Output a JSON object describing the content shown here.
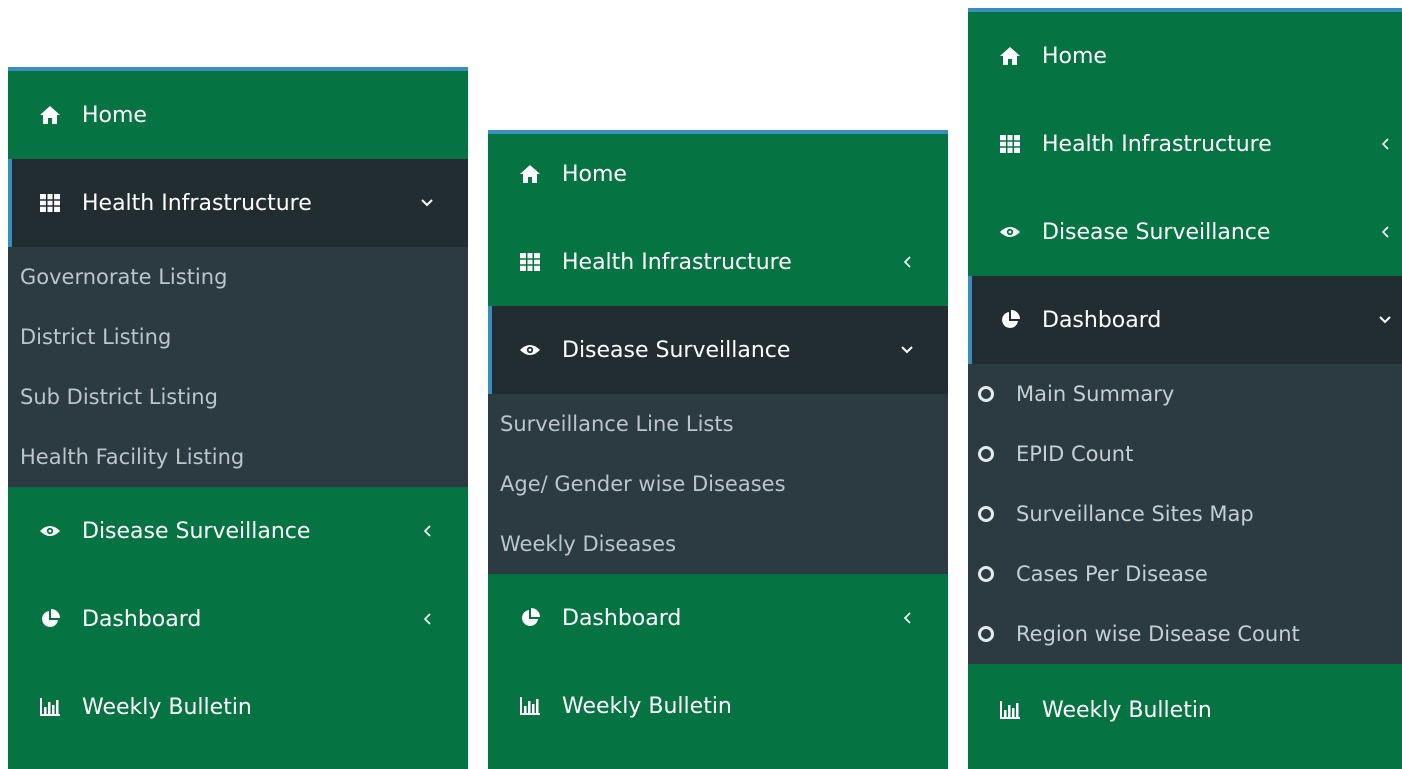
{
  "panel1": {
    "menu": [
      {
        "label": "Home",
        "icon": "home-icon"
      },
      {
        "label": "Health Infrastructure",
        "icon": "grid-icon",
        "state": "expanded"
      },
      {
        "label": "Disease Surveillance",
        "icon": "eye-icon",
        "state": "collapsed"
      },
      {
        "label": "Dashboard",
        "icon": "pie-chart-icon",
        "state": "collapsed"
      },
      {
        "label": "Weekly Bulletin",
        "icon": "bar-chart-icon"
      }
    ],
    "submenu": [
      "Governorate Listing",
      "District Listing",
      "Sub District Listing",
      "Health Facility Listing"
    ]
  },
  "panel2": {
    "menu": [
      {
        "label": "Home",
        "icon": "home-icon"
      },
      {
        "label": "Health Infrastructure",
        "icon": "grid-icon",
        "state": "collapsed"
      },
      {
        "label": "Disease Surveillance",
        "icon": "eye-icon",
        "state": "expanded"
      },
      {
        "label": "Dashboard",
        "icon": "pie-chart-icon",
        "state": "collapsed"
      },
      {
        "label": "Weekly Bulletin",
        "icon": "bar-chart-icon"
      }
    ],
    "submenu": [
      "Surveillance Line Lists",
      "Age/ Gender wise Diseases",
      "Weekly Diseases"
    ]
  },
  "panel3": {
    "menu": [
      {
        "label": "Home",
        "icon": "home-icon"
      },
      {
        "label": "Health Infrastructure",
        "icon": "grid-icon",
        "state": "collapsed"
      },
      {
        "label": "Disease Surveillance",
        "icon": "eye-icon",
        "state": "collapsed"
      },
      {
        "label": "Dashboard",
        "icon": "pie-chart-icon",
        "state": "expanded"
      },
      {
        "label": "Weekly Bulletin",
        "icon": "bar-chart-icon"
      }
    ],
    "submenu": [
      "Main Summary",
      "EPID Count",
      "Surveillance Sites Map",
      "Cases Per Disease",
      "Region wise Disease Count"
    ]
  },
  "colors": {
    "sidebar_bg": "#067442",
    "active_bg": "#222d32",
    "submenu_bg": "#2c3b41",
    "accent": "#3c8dbc"
  }
}
